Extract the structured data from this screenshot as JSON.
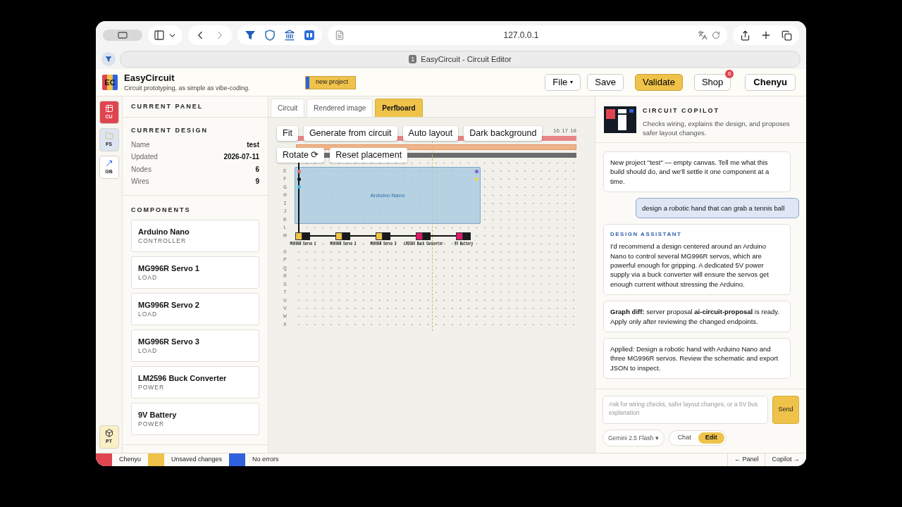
{
  "browser": {
    "url": "127.0.0.1",
    "tab": {
      "number": "1",
      "title": "EasyCircuit - Circuit Editor"
    }
  },
  "header": {
    "logo": "EC",
    "name": "EasyCircuit",
    "tagline": "Circuit prototyping, as simple as vibe-coding.",
    "new_project": "new project",
    "file": "File",
    "file_caret": "▾",
    "save": "Save",
    "validate": "Validate",
    "shop": "Shop",
    "shop_badge": "6",
    "user": "Chenyu"
  },
  "rail": [
    {
      "label": "CU",
      "color": "#df4550"
    },
    {
      "label": "FS",
      "color": "#dde5f3"
    },
    {
      "label": "GB",
      "color": "#ffffff"
    },
    {
      "label": "PT",
      "color": "#fbefc6"
    }
  ],
  "panel": {
    "title": "CURRENT PANEL",
    "design_title": "CURRENT DESIGN",
    "fields": [
      {
        "label": "Name",
        "value": "test"
      },
      {
        "label": "Updated",
        "value": "2026-07-11"
      },
      {
        "label": "Nodes",
        "value": "6"
      },
      {
        "label": "Wires",
        "value": "9"
      }
    ],
    "components_title": "COMPONENTS",
    "components": [
      {
        "name": "Arduino Nano",
        "role": "CONTROLLER"
      },
      {
        "name": "MG996R Servo 1",
        "role": "LOAD"
      },
      {
        "name": "MG996R Servo 2",
        "role": "LOAD"
      },
      {
        "name": "MG996R Servo 3",
        "role": "LOAD"
      },
      {
        "name": "LM2596 Buck Converter",
        "role": "POWER"
      },
      {
        "name": "9V Battery",
        "role": "POWER"
      }
    ]
  },
  "tabs": [
    {
      "label": "Circuit",
      "selected": false
    },
    {
      "label": "Rendered image",
      "selected": false
    },
    {
      "label": "Perfboard",
      "selected": true
    }
  ],
  "perfboard": {
    "toolbar": [
      [
        "Fit",
        "Generate from circuit",
        "Auto layout",
        "Dark background"
      ],
      [
        "Rotate ⟳",
        "Reset placement"
      ]
    ],
    "column_numbers": [
      "16",
      "17",
      "18"
    ],
    "rows": [
      "E",
      "F",
      "G",
      "H",
      "I",
      "J",
      "K",
      "L",
      "M",
      "O",
      "P",
      "Q",
      "R",
      "S",
      "T",
      "U",
      "V",
      "W",
      "X"
    ],
    "board_label": "Arduino Nano",
    "pins": {
      "left": [
        {
          "color": "#e0707a"
        },
        {
          "color": "#1a1a1a"
        },
        {
          "color": "#3fb8d8"
        }
      ],
      "right": [
        {
          "color": "#8a5cd6"
        },
        {
          "color": "#e8d35a"
        }
      ]
    },
    "parts": [
      {
        "label": "MG996R Servo 1",
        "color": "#efc24a"
      },
      {
        "label": "MG996R Servo 2",
        "color": "#efc24a"
      },
      {
        "label": "MG996R Servo 3",
        "color": "#efc24a"
      },
      {
        "label": "LM2596 Buck Converter",
        "color": "#e0176a"
      },
      {
        "label": "9V Battery",
        "color": "#e0176a"
      }
    ]
  },
  "copilot": {
    "title": "CIRCUIT COPILOT",
    "subtitle": "Checks wiring, explains the design, and proposes safer layout changes.",
    "messages": [
      {
        "kind": "assistant",
        "text": "New project \"test\" — empty canvas. Tell me what this build should do, and we'll settle it one component at a time."
      },
      {
        "kind": "user",
        "text": "design a robotic hand that can grab a tennis ball"
      },
      {
        "kind": "assistant",
        "heading": "DESIGN ASSISTANT",
        "text": "I'd recommend a design centered around an Arduino Nano to control several MG996R servos, which are powerful enough for gripping. A dedicated 5V power supply via a buck converter will ensure the servos get enough current without stressing the Arduino."
      },
      {
        "kind": "assistant",
        "text": "**Graph diff:** server proposal **ai-circuit-proposal** is ready. Apply only after reviewing the changed endpoints."
      },
      {
        "kind": "assistant",
        "text": "Applied: Design a robotic hand with Arduino Nano and three MG996R servos. Review the schematic and export JSON to inspect."
      }
    ],
    "input": {
      "placeholder": "Ask for wiring checks, safer layout changes, or a 5V bus explanation"
    },
    "send": "Send",
    "model": "Gemini 2.5 Flash ▾",
    "modes": [
      {
        "label": "Chat",
        "selected": false
      },
      {
        "label": "Edit",
        "selected": true
      }
    ]
  },
  "status": {
    "segments": [
      {
        "label": "Chenyu",
        "color": "#df4550"
      },
      {
        "label": "Unsaved changes",
        "color": "#efc24a"
      },
      {
        "label": "No errors",
        "color": "#2f62dc"
      }
    ],
    "links": [
      "← Panel",
      "Copilot →"
    ]
  }
}
